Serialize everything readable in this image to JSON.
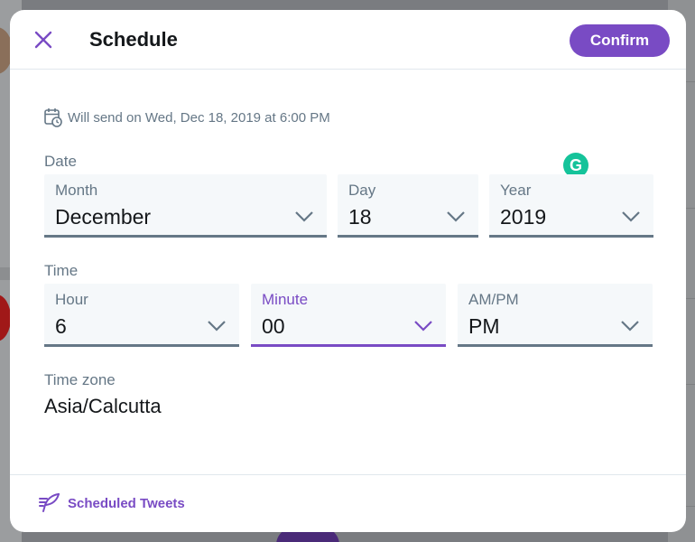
{
  "modal": {
    "title": "Schedule",
    "confirm_label": "Confirm",
    "send_note": "Will send on Wed, Dec 18, 2019 at 6:00 PM"
  },
  "date": {
    "section_label": "Date",
    "month": {
      "label": "Month",
      "value": "December"
    },
    "day": {
      "label": "Day",
      "value": "18"
    },
    "year": {
      "label": "Year",
      "value": "2019"
    }
  },
  "time": {
    "section_label": "Time",
    "hour": {
      "label": "Hour",
      "value": "6"
    },
    "minute": {
      "label": "Minute",
      "value": "00"
    },
    "ampm": {
      "label": "AM/PM",
      "value": "PM"
    }
  },
  "timezone": {
    "label": "Time zone",
    "value": "Asia/Calcutta"
  },
  "footer": {
    "scheduled_label": "Scheduled Tweets"
  },
  "colors": {
    "accent": "#794bc4",
    "muted_text": "#657786",
    "field_bg": "#f5f8fa",
    "grammarly": "#15c39a"
  },
  "icons": {
    "close": "close-icon",
    "calendar": "calendar-clock-icon",
    "chevron": "chevron-down-icon",
    "quill": "quill-icon",
    "grammarly": "grammarly-icon"
  }
}
